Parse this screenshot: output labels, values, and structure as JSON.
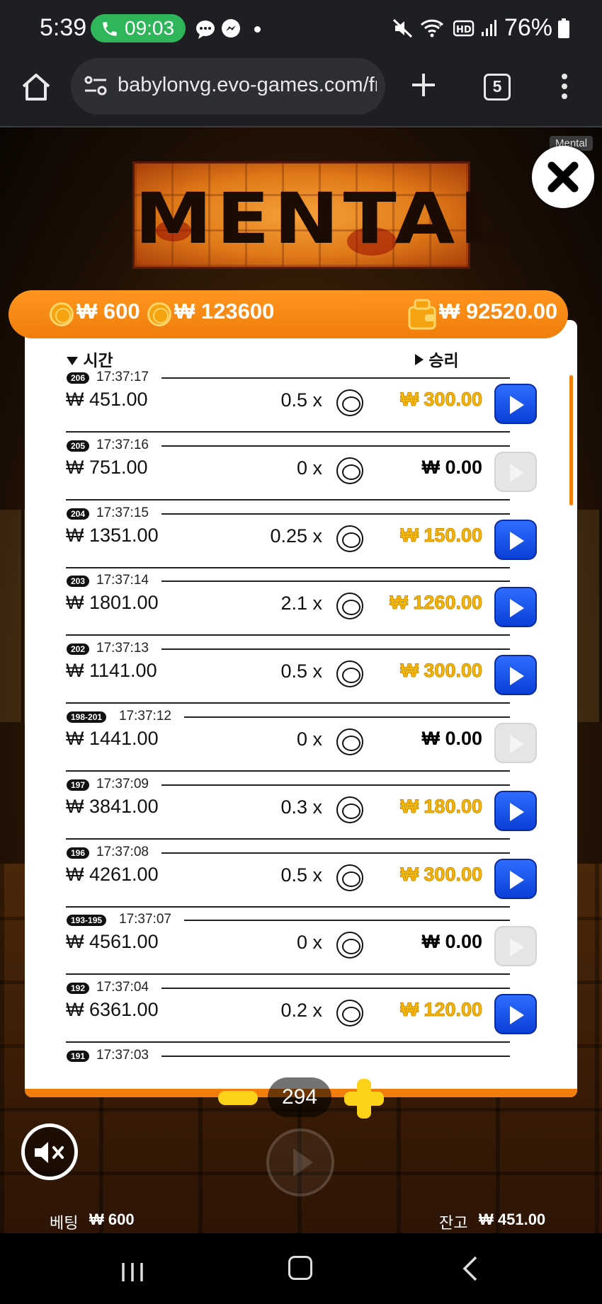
{
  "status_bar": {
    "time": "5:39",
    "call_timer": "09:03",
    "battery": "76%"
  },
  "browser": {
    "url": "babylonvg.evo-games.com/fro",
    "tab_count": "5"
  },
  "game": {
    "logo_text": "MENTAL",
    "tag": "Mental",
    "header": {
      "bet": "₩ 600",
      "max_win": "₩ 123600",
      "balance_display": "₩ 92520.00"
    },
    "columns": {
      "time": "시간",
      "win": "승리"
    },
    "rows": [
      {
        "id": "206",
        "time": "17:37:17",
        "bet": "₩ 451.00",
        "mult": "0.5 x",
        "win": "₩ 300.00",
        "win_style": "gold",
        "play_enabled": true
      },
      {
        "id": "205",
        "time": "17:37:16",
        "bet": "₩ 751.00",
        "mult": "0 x",
        "win": "₩ 0.00",
        "win_style": "black",
        "play_enabled": false
      },
      {
        "id": "204",
        "time": "17:37:15",
        "bet": "₩ 1351.00",
        "mult": "0.25 x",
        "win": "₩ 150.00",
        "win_style": "gold",
        "play_enabled": true
      },
      {
        "id": "203",
        "time": "17:37:14",
        "bet": "₩ 1801.00",
        "mult": "2.1 x",
        "win": "₩ 1260.00",
        "win_style": "gold",
        "play_enabled": true
      },
      {
        "id": "202",
        "time": "17:37:13",
        "bet": "₩ 1141.00",
        "mult": "0.5 x",
        "win": "₩ 300.00",
        "win_style": "gold",
        "play_enabled": true
      },
      {
        "id": "198-201",
        "time": "17:37:12",
        "bet": "₩ 1441.00",
        "mult": "0 x",
        "win": "₩ 0.00",
        "win_style": "black",
        "play_enabled": false
      },
      {
        "id": "197",
        "time": "17:37:09",
        "bet": "₩ 3841.00",
        "mult": "0.3 x",
        "win": "₩ 180.00",
        "win_style": "gold",
        "play_enabled": true
      },
      {
        "id": "196",
        "time": "17:37:08",
        "bet": "₩ 4261.00",
        "mult": "0.5 x",
        "win": "₩ 300.00",
        "win_style": "gold",
        "play_enabled": true
      },
      {
        "id": "193-195",
        "time": "17:37:07",
        "bet": "₩ 4561.00",
        "mult": "0 x",
        "win": "₩ 0.00",
        "win_style": "black",
        "play_enabled": false
      },
      {
        "id": "192",
        "time": "17:37:04",
        "bet": "₩ 6361.00",
        "mult": "0.2 x",
        "win": "₩ 120.00",
        "win_style": "gold",
        "play_enabled": true
      },
      {
        "id": "191",
        "time": "17:37:03",
        "bet": "",
        "mult": "",
        "win": "",
        "win_style": "gold",
        "play_enabled": true
      }
    ],
    "bet_count": "294",
    "footer": {
      "bet_label": "베팅",
      "bet_value": "₩ 600",
      "balance_label": "잔고",
      "balance_value": "₩ 451.00"
    }
  }
}
